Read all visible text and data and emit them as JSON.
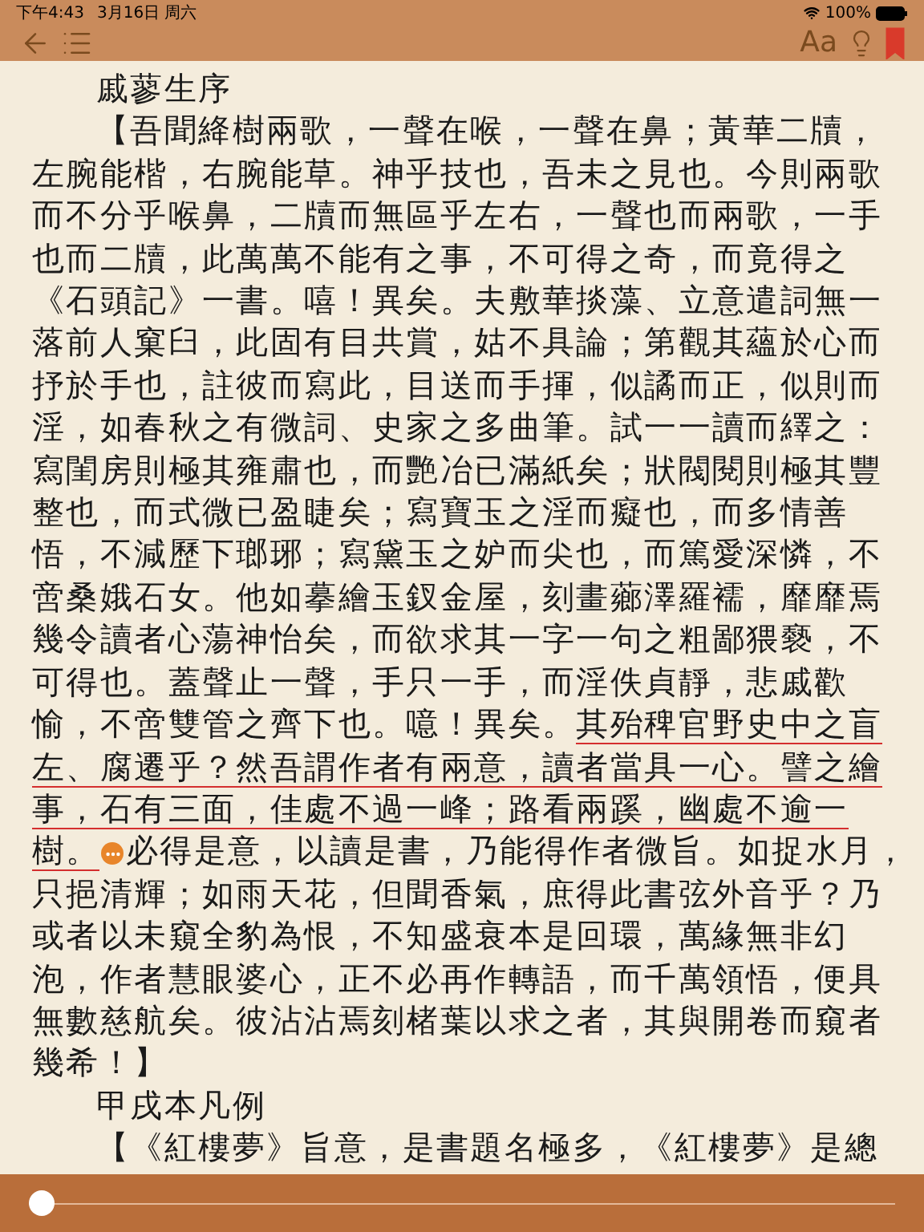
{
  "status_bar": {
    "time": "下午4:43",
    "date": "3月16日 周六",
    "battery": "100%"
  },
  "toolbar": {
    "font_button": "Aa",
    "bookmarked": true
  },
  "lines": [
    {
      "indent": true,
      "segments": [
        {
          "text": "戚蓼生序",
          "underlined": false
        }
      ]
    },
    {
      "indent": true,
      "segments": [
        {
          "text": "【吾聞絳樹兩歌，一聲在喉，一聲在鼻；黃華二牘，",
          "underlined": false
        }
      ]
    },
    {
      "indent": false,
      "segments": [
        {
          "text": "左腕能楷，右腕能草。神乎技也，吾未之見也。今則兩歌",
          "underlined": false
        }
      ]
    },
    {
      "indent": false,
      "segments": [
        {
          "text": "而不分乎喉鼻，二牘而無區乎左右，一聲也而兩歌，一手",
          "underlined": false
        }
      ]
    },
    {
      "indent": false,
      "segments": [
        {
          "text": "也而二牘，此萬萬不能有之事，不可得之奇，而竟得之",
          "underlined": false
        }
      ]
    },
    {
      "indent": false,
      "segments": [
        {
          "text": "《石頭記》一書。嘻！異矣。夫敷華掞藻、立意遣詞無一",
          "underlined": false
        }
      ]
    },
    {
      "indent": false,
      "segments": [
        {
          "text": "落前人窠臼，此固有目共賞，姑不具論；第觀其蘊於心而",
          "underlined": false
        }
      ]
    },
    {
      "indent": false,
      "segments": [
        {
          "text": "抒於手也，註彼而寫此，目送而手揮，似譎而正，似則而",
          "underlined": false
        }
      ]
    },
    {
      "indent": false,
      "segments": [
        {
          "text": "淫，如春秋之有微詞、史家之多曲筆。試一一讀而繹之：",
          "underlined": false
        }
      ]
    },
    {
      "indent": false,
      "segments": [
        {
          "text": "寫閨房則極其雍肅也，而艷冶已滿紙矣；狀閥閱則極其豐",
          "underlined": false
        }
      ]
    },
    {
      "indent": false,
      "segments": [
        {
          "text": "整也，而式微已盈睫矣；寫寶玉之淫而癡也，而多情善",
          "underlined": false
        }
      ]
    },
    {
      "indent": false,
      "segments": [
        {
          "text": "悟，不減歷下瑯琊；寫黛玉之妒而尖也，而篤愛深憐，不",
          "underlined": false
        }
      ]
    },
    {
      "indent": false,
      "segments": [
        {
          "text": "啻桑娥石女。他如摹繪玉釵金屋，刻畫薌澤羅襦，靡靡焉",
          "underlined": false
        }
      ]
    },
    {
      "indent": false,
      "segments": [
        {
          "text": "幾令讀者心蕩神怡矣，而欲求其一字一句之粗鄙猥褻，不",
          "underlined": false
        }
      ]
    },
    {
      "indent": false,
      "segments": [
        {
          "text": "可得也。蓋聲止一聲，手只一手，而淫佚貞靜，悲戚歡",
          "underlined": false
        }
      ]
    },
    {
      "indent": false,
      "segments": [
        {
          "text": "愉，不啻雙管之齊下也。噫！異矣。",
          "underlined": false
        },
        {
          "text": "其殆稗官野史中之盲",
          "underlined": true
        }
      ]
    },
    {
      "indent": false,
      "segments": [
        {
          "text": "左、腐遷乎？然吾謂作者有兩意，讀者當具一心。譬之繪",
          "underlined": true
        }
      ]
    },
    {
      "indent": false,
      "segments": [
        {
          "text": "事，石有三面，佳處不過一峰；路看兩蹊，幽處不逾一",
          "underlined": true
        }
      ]
    },
    {
      "indent": false,
      "segments": [
        {
          "text": "樹。",
          "underlined": true
        },
        {
          "text": "必得是意，以讀是書，乃能得作者微旨。如捉水月，",
          "underlined": false
        }
      ]
    },
    {
      "indent": false,
      "segments": [
        {
          "text": "只挹清輝；如雨天花，但聞香氣，庶得此書弦外音乎？乃",
          "underlined": false
        }
      ]
    },
    {
      "indent": false,
      "segments": [
        {
          "text": "或者以未窺全豹為恨，不知盛衰本是回環，萬緣無非幻",
          "underlined": false
        }
      ]
    },
    {
      "indent": false,
      "segments": [
        {
          "text": "泡，作者慧眼婆心，正不必再作轉語，而千萬領悟，便具",
          "underlined": false
        }
      ]
    },
    {
      "indent": false,
      "segments": [
        {
          "text": "無數慈航矣。彼沾沾焉刻楮葉以求之者，其與開卷而窺者",
          "underlined": false
        }
      ]
    },
    {
      "indent": false,
      "segments": [
        {
          "text": "幾希！】",
          "underlined": false
        }
      ]
    },
    {
      "indent": true,
      "segments": [
        {
          "text": "甲戌本凡例",
          "underlined": false
        }
      ]
    },
    {
      "indent": true,
      "segments": [
        {
          "text": "【《紅樓夢》旨意，是書題名極多，《紅樓夢》是總",
          "underlined": false
        }
      ]
    }
  ],
  "progress": {
    "level": 0
  }
}
